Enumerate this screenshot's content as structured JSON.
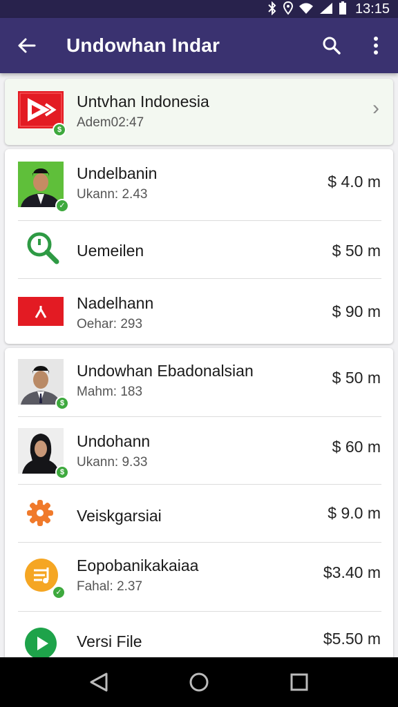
{
  "status_bar": {
    "time": "13:15",
    "icons": [
      "bluetooth-icon",
      "location-icon",
      "wifi-icon",
      "signal-icon",
      "battery-icon"
    ]
  },
  "app_bar": {
    "title": "Undowhan Indar",
    "back_icon": "arrow-back-icon",
    "search_icon": "search-icon",
    "menu_icon": "more-vert-icon",
    "background": "#3a3270",
    "status_background": "#28224c"
  },
  "featured": {
    "name": "Untvhan Indonesia",
    "sub": "Adem02:47",
    "icon": "play-logo-icon",
    "chevron": "›"
  },
  "card1": {
    "items": [
      {
        "name": "Undelbanin",
        "sub": "Ukann: 2.43",
        "price": "$ 4.0 m",
        "icon": "person-photo"
      },
      {
        "name": "Uemeilen",
        "sub": "",
        "price": "$ 50 m",
        "icon": "search-clock-icon"
      },
      {
        "name": "Nadelhann",
        "sub": "Oehar: 293",
        "price": "$ 90 m",
        "icon": "red-flag-icon"
      }
    ]
  },
  "card2": {
    "items": [
      {
        "name": "Undowhan Ebadonalsian",
        "sub": "Mahm: 183",
        "price": "$ 50 m",
        "icon": "person-photo"
      },
      {
        "name": "Undohann",
        "sub": "Ukann: 9.33",
        "price": "$ 60 m",
        "icon": "person-photo-hijab"
      },
      {
        "name": "Veiskgarsiai",
        "sub": "",
        "price": "$ 9.0 m",
        "icon": "gear-icon"
      },
      {
        "name": "Eopobanikakaiaa",
        "sub": "Fahal: 2.37",
        "price": "$3.40 m",
        "icon": "music-note-icon"
      },
      {
        "name": "Versi File",
        "sub": "",
        "price": "$5.50 m",
        "icon": "play-circle-icon"
      }
    ]
  },
  "nav_bar": {
    "back": "nav-back-icon",
    "home": "nav-home-icon",
    "recents": "nav-recents-icon"
  }
}
